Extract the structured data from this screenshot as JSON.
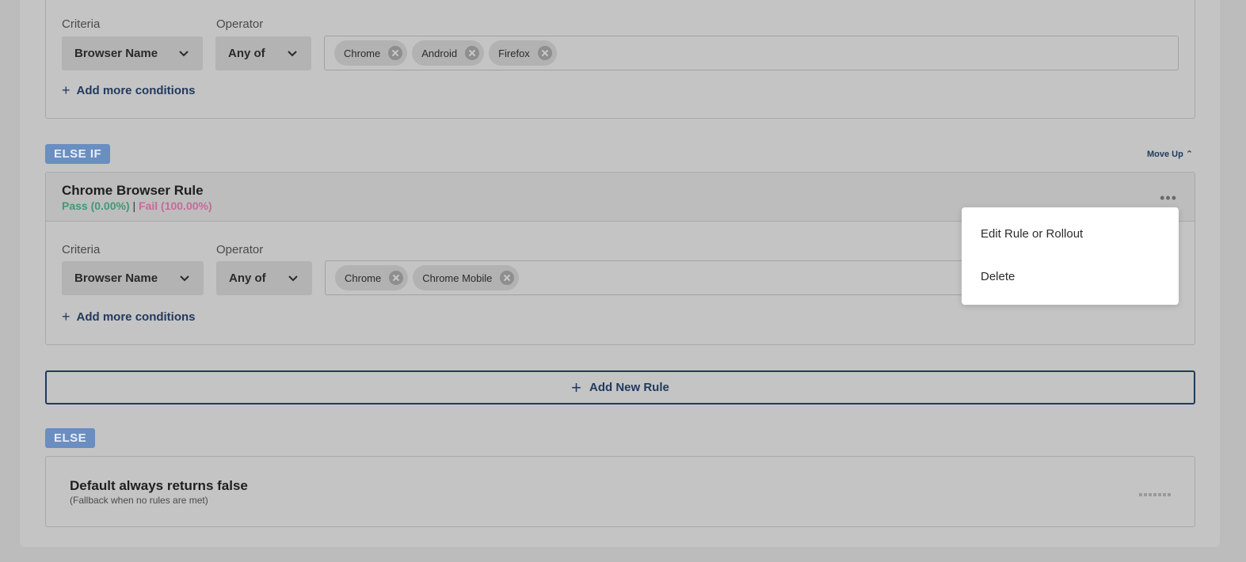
{
  "rule1": {
    "criteria_label": "Criteria",
    "operator_label": "Operator",
    "criteria_value": "Browser Name",
    "operator_value": "Any of",
    "chips": [
      "Chrome",
      "Android",
      "Firefox"
    ],
    "add_conditions": "Add more conditions"
  },
  "else_if_tag": "ELSE IF",
  "move_up": "Move Up ⌃",
  "rule2": {
    "title": "Chrome Browser Rule",
    "pass": "Pass (0.00%)",
    "separator": "|",
    "fail": "Fail (100.00%)",
    "criteria_label": "Criteria",
    "operator_label": "Operator",
    "criteria_value": "Browser Name",
    "operator_value": "Any of",
    "chips": [
      "Chrome",
      "Chrome Mobile"
    ],
    "add_conditions": "Add more conditions"
  },
  "add_new_rule": "Add New Rule",
  "else_tag": "ELSE",
  "default_rule": {
    "title": "Default always returns false",
    "subtitle": "(Fallback when no rules are met)"
  },
  "context_menu": {
    "items": [
      "Edit Rule or Rollout",
      "Delete"
    ]
  },
  "colors": {
    "accent": "#223a5e",
    "tag": "#6a8ec0",
    "pass": "#3f9a77",
    "fail": "#c66a9a"
  }
}
